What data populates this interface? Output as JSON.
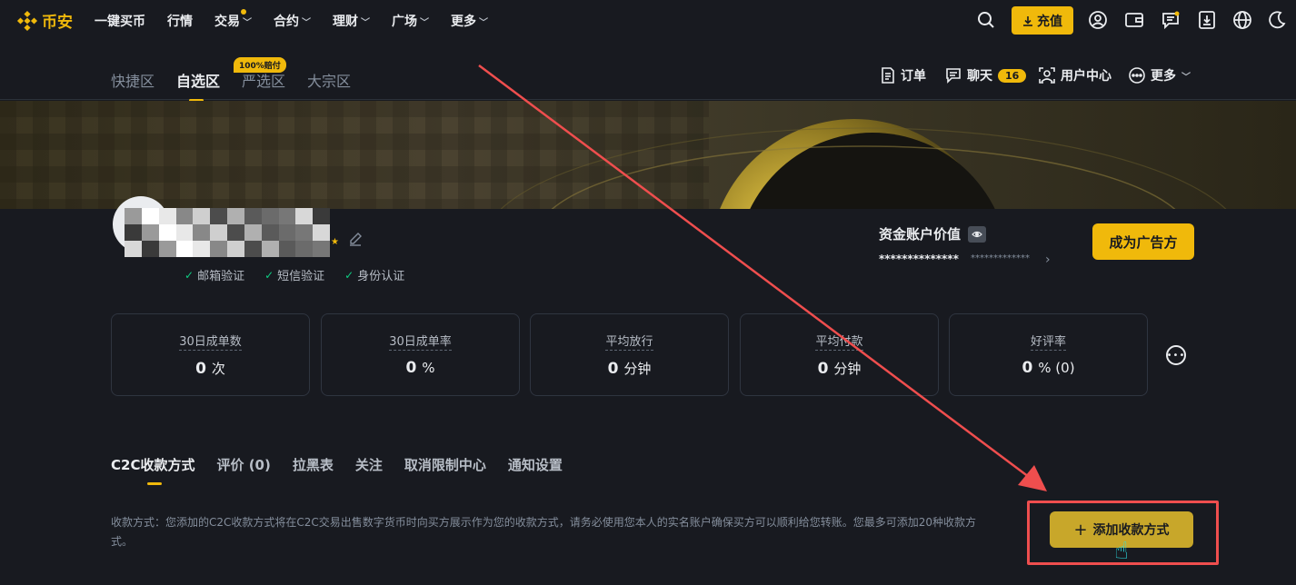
{
  "nav": {
    "brand": "币安",
    "items": [
      {
        "label": "一键买币"
      },
      {
        "label": "行情"
      },
      {
        "label": "交易",
        "caret": "﹀",
        "dot": true
      },
      {
        "label": "合约",
        "caret": "﹀"
      },
      {
        "label": "理财",
        "caret": "﹀"
      },
      {
        "label": "广场",
        "caret": "﹀"
      },
      {
        "label": "更多",
        "caret": "﹀"
      }
    ],
    "deposit_label": "充值"
  },
  "subnav": {
    "zones": [
      {
        "label": "快捷区",
        "active": false
      },
      {
        "label": "自选区",
        "active": true
      },
      {
        "label": "严选区",
        "active": false
      },
      {
        "label": "大宗区",
        "active": false
      }
    ],
    "zone_badge": "100%赔付",
    "orders_label": "订单",
    "chat_label": "聊天",
    "chat_count": "16",
    "user_center_label": "用户中心",
    "more_label": "更多"
  },
  "profile": {
    "verifications": [
      "邮箱验证",
      "短信验证",
      "身份认证"
    ],
    "fund_title": "资金账户价值",
    "fund_value": "**************",
    "fund_value_sub": "*************",
    "advertiser_button": "成为广告方"
  },
  "stats": [
    {
      "label": "30日成单数",
      "value": "0",
      "unit": "次"
    },
    {
      "label": "30日成单率",
      "value": "0",
      "unit": "%"
    },
    {
      "label": "平均放行",
      "value": "0",
      "unit": "分钟"
    },
    {
      "label": "平均付款",
      "value": "0",
      "unit": "分钟"
    },
    {
      "label": "好评率",
      "value": "0",
      "unit": "% (0)"
    }
  ],
  "tabs": [
    {
      "label": "C2C收款方式",
      "active": true
    },
    {
      "label": "评价 (0)",
      "active": false
    },
    {
      "label": "拉黑表",
      "active": false
    },
    {
      "label": "关注",
      "active": false
    },
    {
      "label": "取消限制中心",
      "active": false
    },
    {
      "label": "通知设置",
      "active": false
    }
  ],
  "payment": {
    "description": "收款方式：您添加的C2C收款方式将在C2C交易出售数字货币时向买方展示作为您的收款方式，请务必使用您本人的实名账户确保买方可以顺利给您转账。您最多可添加20种收款方式。",
    "add_button": "添加收款方式"
  },
  "colors": {
    "accent": "#f0b90b",
    "background": "#181a20",
    "annotation_red": "#ef4e4e",
    "success": "#0ecb81"
  }
}
